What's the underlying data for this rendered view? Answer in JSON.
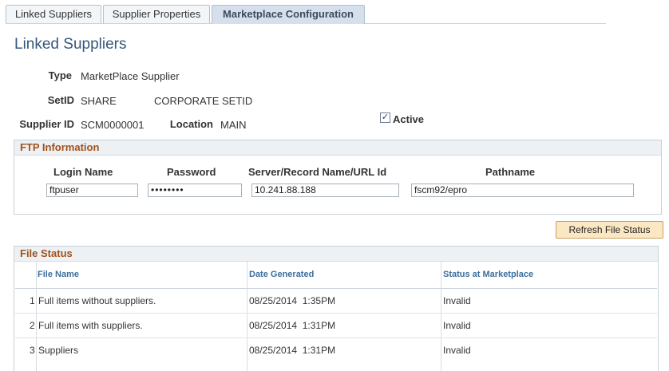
{
  "tabs": [
    {
      "label": "Linked Suppliers"
    },
    {
      "label": "Supplier Properties"
    },
    {
      "label": "Marketplace Configuration"
    }
  ],
  "page_title": "Linked Suppliers",
  "fields": {
    "type_label": "Type",
    "type_value": "MarketPlace Supplier",
    "setid_label": "SetID",
    "setid_value": "SHARE",
    "setid_desc": "CORPORATE SETID",
    "supplier_id_label": "Supplier ID",
    "supplier_id_value": "SCM0000001",
    "location_label": "Location",
    "location_value": "MAIN",
    "active_label": "Active",
    "active_checked": true
  },
  "ftp": {
    "title": "FTP Information",
    "login_label": "Login Name",
    "login_value": "ftpuser",
    "password_label": "Password",
    "password_value": "••••••••",
    "server_label": "Server/Record Name/URL Id",
    "server_value": "10.241.88.188",
    "path_label": "Pathname",
    "path_value": "fscm92/epro"
  },
  "refresh_button": "Refresh File Status",
  "file_status": {
    "title": "File Status",
    "columns": [
      "File Name",
      "Date Generated",
      "Status at Marketplace"
    ],
    "rows": [
      {
        "num": "1",
        "name": "Full items without suppliers.",
        "date": "08/25/2014  1:35PM",
        "status": "Invalid"
      },
      {
        "num": "2",
        "name": "Full items with suppliers.",
        "date": "08/25/2014  1:31PM",
        "status": "Invalid"
      },
      {
        "num": "3",
        "name": "Suppliers",
        "date": "08/25/2014  1:31PM",
        "status": "Invalid"
      }
    ]
  }
}
